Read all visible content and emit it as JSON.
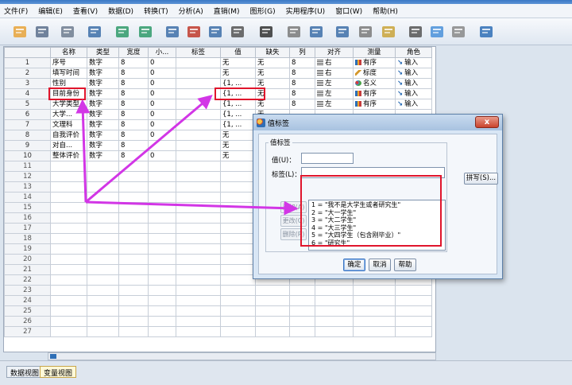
{
  "menu": [
    "文件(F)",
    "编辑(E)",
    "查看(V)",
    "数据(D)",
    "转换(T)",
    "分析(A)",
    "直销(M)",
    "图形(G)",
    "实用程序(U)",
    "窗口(W)",
    "帮助(H)"
  ],
  "toolbar": [
    {
      "name": "open-icon",
      "color": "#e8a33a"
    },
    {
      "name": "save-icon",
      "color": "#5a6f8c"
    },
    {
      "name": "print-icon",
      "color": "#6f7c8f"
    },
    {
      "name": "dialog-recall-icon",
      "color": "#3d6ea8"
    },
    {
      "name": "undo-icon",
      "color": "#2f9a6a"
    },
    {
      "name": "redo-icon",
      "color": "#2f9a6a"
    },
    {
      "name": "goto-case-icon",
      "color": "#3d6ea8"
    },
    {
      "name": "goto-variable-icon",
      "color": "#c0392b"
    },
    {
      "name": "variables-icon",
      "color": "#3d6ea8"
    },
    {
      "name": "run-descriptives-icon",
      "color": "#555"
    },
    {
      "name": "find-icon",
      "color": "#333"
    },
    {
      "name": "insert-cases-icon",
      "color": "#7a7a7a"
    },
    {
      "name": "insert-variable-icon",
      "color": "#3d6ea8"
    },
    {
      "name": "split-file-icon",
      "color": "#3d6ea8"
    },
    {
      "name": "weight-cases-icon",
      "color": "#7a7a7a"
    },
    {
      "name": "select-cases-icon",
      "color": "#c9a33a"
    },
    {
      "name": "value-labels-icon",
      "color": "#555"
    },
    {
      "name": "use-sets-icon",
      "color": "#4a90d9"
    },
    {
      "name": "show-all-icon",
      "color": "#888"
    },
    {
      "name": "spell-check-icon",
      "color": "#2f6fb6"
    }
  ],
  "grid": {
    "columns": [
      "",
      "名称",
      "类型",
      "宽度",
      "小...",
      "标签",
      "值",
      "缺失",
      "列",
      "对齐",
      "测量",
      "角色"
    ],
    "rows": [
      {
        "num": "1",
        "name": "序号",
        "type": "数字",
        "width": "8",
        "decimals": "0",
        "label": "",
        "values": "无",
        "missing": "无",
        "columns": "8",
        "align": "右",
        "measure": "有序",
        "measure_icon": "ordinal",
        "role": "输入"
      },
      {
        "num": "2",
        "name": "填写时间",
        "type": "数字",
        "width": "8",
        "decimals": "0",
        "label": "",
        "values": "无",
        "missing": "无",
        "columns": "8",
        "align": "右",
        "measure": "标度",
        "measure_icon": "scale",
        "role": "输入"
      },
      {
        "num": "3",
        "name": "性别",
        "type": "数字",
        "width": "8",
        "decimals": "0",
        "label": "",
        "values": "{1, ...",
        "missing": "无",
        "columns": "8",
        "align": "左",
        "measure": "名义",
        "measure_icon": "nominal",
        "role": "输入"
      },
      {
        "num": "4",
        "name": "目前身份",
        "type": "数字",
        "width": "8",
        "decimals": "0",
        "label": "",
        "values": "{1, ...",
        "missing": "无",
        "columns": "8",
        "align": "左",
        "measure": "有序",
        "measure_icon": "ordinal",
        "role": "输入"
      },
      {
        "num": "5",
        "name": "大学类型",
        "type": "数字",
        "width": "8",
        "decimals": "0",
        "label": "",
        "values": "{1, ...",
        "missing": "无",
        "columns": "8",
        "align": "左",
        "measure": "有序",
        "measure_icon": "ordinal",
        "role": "输入"
      },
      {
        "num": "6",
        "name": "大学...",
        "type": "数字",
        "width": "8",
        "decimals": "0",
        "label": "",
        "values": "{1, ...",
        "missing": "无",
        "columns": "",
        "align": "",
        "measure": "",
        "measure_icon": "",
        "role": ""
      },
      {
        "num": "7",
        "name": "文理科",
        "type": "数字",
        "width": "8",
        "decimals": "0",
        "label": "",
        "values": "{1, ...",
        "missing": "无",
        "columns": "",
        "align": "",
        "measure": "",
        "measure_icon": "",
        "role": ""
      },
      {
        "num": "8",
        "name": "自我评价",
        "type": "数字",
        "width": "8",
        "decimals": "0",
        "label": "",
        "values": "无",
        "missing": "",
        "columns": "",
        "align": "",
        "measure": "",
        "measure_icon": "",
        "role": ""
      },
      {
        "num": "9",
        "name": "对自...",
        "type": "数字",
        "width": "8",
        "decimals": "",
        "label": "",
        "values": "无",
        "missing": "",
        "columns": "",
        "align": "",
        "measure": "",
        "measure_icon": "",
        "role": ""
      },
      {
        "num": "10",
        "name": "整体评价",
        "type": "数字",
        "width": "8",
        "decimals": "0",
        "label": "",
        "values": "无",
        "missing": "",
        "columns": "",
        "align": "",
        "measure": "",
        "measure_icon": "",
        "role": ""
      }
    ],
    "empty_rows": [
      "11",
      "12",
      "13",
      "14",
      "15",
      "16",
      "17",
      "18",
      "19",
      "20",
      "21",
      "22",
      "23",
      "24",
      "25",
      "26",
      "27"
    ]
  },
  "tabs": {
    "data_view": "数据视图",
    "variable_view": "变量视图"
  },
  "dialog": {
    "title": "值标签",
    "group_label": "值标签",
    "value_label": "值(U)：",
    "label_label": "标签(L)：",
    "add_button": "添加(A)",
    "change_button": "更改(C)",
    "remove_button": "删除(R)",
    "spell_button": "拼写(S)...",
    "ok_button": "确定",
    "cancel_button": "取消",
    "help_button": "帮助",
    "close_button": "x",
    "value_list": [
      "1 = \"我不是大学生或者研究生\"",
      "2 = \"大一学生\"",
      "3 = \"大二学生\"",
      "4 = \"大三学生\"",
      "5 = \"大四学生（包含刚毕业）\"",
      "6 = \"研究生\""
    ]
  },
  "colors": {
    "highlight": "#e0152c",
    "arrow": "#d236e6"
  }
}
